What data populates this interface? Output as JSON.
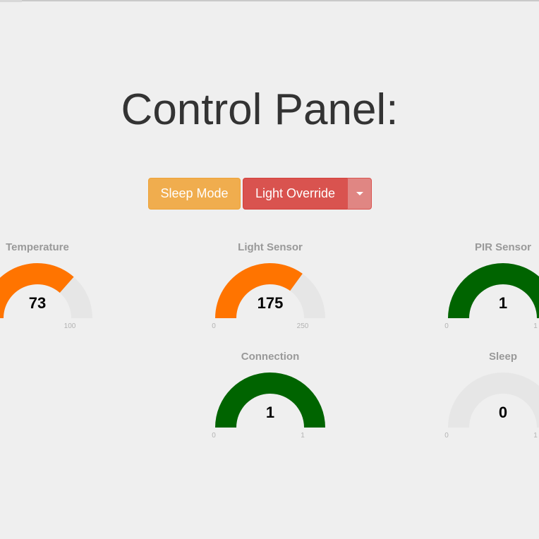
{
  "page": {
    "title": "Control Panel:"
  },
  "buttons": {
    "sleep_mode": "Sleep Mode",
    "light_override": "Light Override",
    "dropdown": "caret-down-icon"
  },
  "colors": {
    "orange": "#ff7400",
    "green": "#006400",
    "track": "#e6e6e6"
  },
  "gauges": [
    {
      "key": "temperature",
      "label": "Temperature",
      "value": "73",
      "min": "0",
      "max": "100",
      "fraction": 0.73,
      "color": "#ff7400"
    },
    {
      "key": "light",
      "label": "Light Sensor",
      "value": "175",
      "min": "0",
      "max": "250",
      "fraction": 0.7,
      "color": "#ff7400"
    },
    {
      "key": "pir",
      "label": "PIR Sensor",
      "value": "1",
      "min": "0",
      "max": "1",
      "fraction": 1.0,
      "color": "#006400"
    },
    {
      "key": "connection",
      "label": "Connection",
      "value": "1",
      "min": "0",
      "max": "1",
      "fraction": 1.0,
      "color": "#006400"
    },
    {
      "key": "sleep",
      "label": "Sleep",
      "value": "0",
      "min": "0",
      "max": "1",
      "fraction": 0.0,
      "color": "#006400"
    }
  ]
}
